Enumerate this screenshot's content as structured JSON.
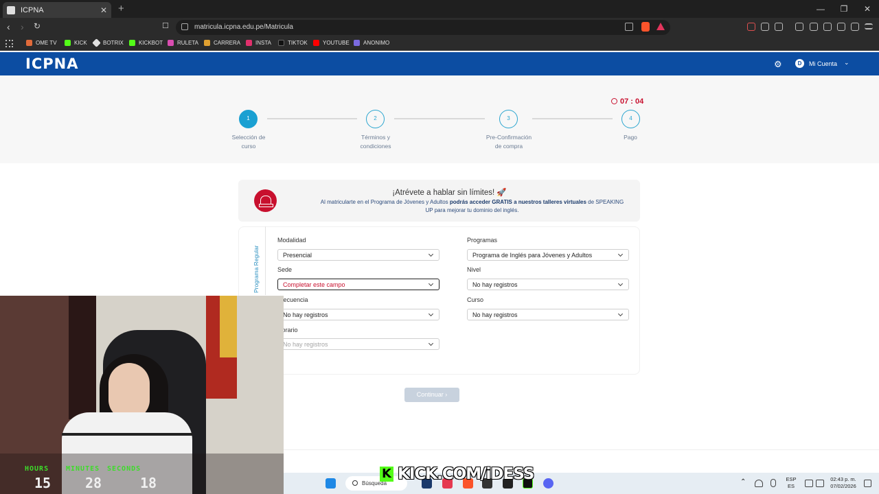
{
  "browser": {
    "tab_title": "ICPNA",
    "tab_close": "✕",
    "new_tab": "+",
    "url": "matricula.icpna.edu.pe/Matricula",
    "window_controls": [
      "—",
      "❐",
      "✕"
    ],
    "bookmarks": [
      {
        "label": "OME TV",
        "color": "#e06a3a"
      },
      {
        "label": "KICK",
        "color": "#53fc18"
      },
      {
        "label": "BOTRIX",
        "color": "#e0e0e0"
      },
      {
        "label": "KICKBOT",
        "color": "#53fc18"
      },
      {
        "label": "RULETA",
        "color": "#d94db0"
      },
      {
        "label": "CARRERA",
        "color": "#e0a030"
      },
      {
        "label": "INSTA",
        "color": "#e1306c"
      },
      {
        "label": "TIKTOK",
        "color": "#222222"
      },
      {
        "label": "YOUTUBE",
        "color": "#ff0000"
      },
      {
        "label": "ANONIMO",
        "color": "#7a6ae0"
      }
    ]
  },
  "header": {
    "logo": "ICPNA",
    "account_initial": "D",
    "account_label": "Mi Cuenta",
    "gear_icon": "⚙",
    "caret": "⌄"
  },
  "timer": "07 : 04",
  "steps": [
    {
      "number": "1",
      "label_line1": "Selección de",
      "label_line2": "curso",
      "active": true
    },
    {
      "number": "2",
      "label_line1": "Términos y",
      "label_line2": "condiciones",
      "active": false
    },
    {
      "number": "3",
      "label_line1": "Pre-Confirmación",
      "label_line2": "de compra",
      "active": false
    },
    {
      "number": "4",
      "label_line1": "Pago",
      "label_line2": "",
      "active": false
    }
  ],
  "promo": {
    "title": "¡Atrévete a hablar sin límites! 🚀",
    "text_before": "Al matricularte en el Programa de Jóvenes y Adultos ",
    "text_bold": "podrás acceder GRATIS a nuestros talleres virtuales",
    "text_after": " de SPEAKING UP para mejorar tu dominio del inglés."
  },
  "form": {
    "side_tab": "Programa Regular",
    "modalidad": {
      "label": "Modalidad",
      "value": "Presencial"
    },
    "programas": {
      "label": "Programas",
      "value": "Programa de Inglés para Jóvenes y Adultos"
    },
    "sede": {
      "label": "Sede",
      "value": "Completar este campo"
    },
    "nivel": {
      "label": "Nivel",
      "value": "No hay registros"
    },
    "frecuencia": {
      "label": "Frecuencia",
      "value": "No hay registros"
    },
    "curso": {
      "label": "Curso",
      "value": "No hay registros"
    },
    "horario": {
      "label": "Horario",
      "value": "No hay registros"
    },
    "continue_label": "Continuar ›"
  },
  "overlay": {
    "countdown_labels": [
      "HOURS",
      "MINUTES",
      "SECONDS"
    ],
    "countdown_values": [
      "15",
      "28",
      "18"
    ],
    "kick_logo": "K",
    "kick_text": "KICK.COM/iDESS"
  },
  "taskbar": {
    "search": "Búsqueda",
    "lang_line1": "ESP",
    "lang_line2": "ES",
    "time": "02:43 p. m.",
    "date": "07/02/2026"
  },
  "colors": {
    "brand_blue": "#0c4da2",
    "accent_cyan": "#1aa0d2",
    "error_red": "#c8102e",
    "kick_green": "#53fc18"
  }
}
